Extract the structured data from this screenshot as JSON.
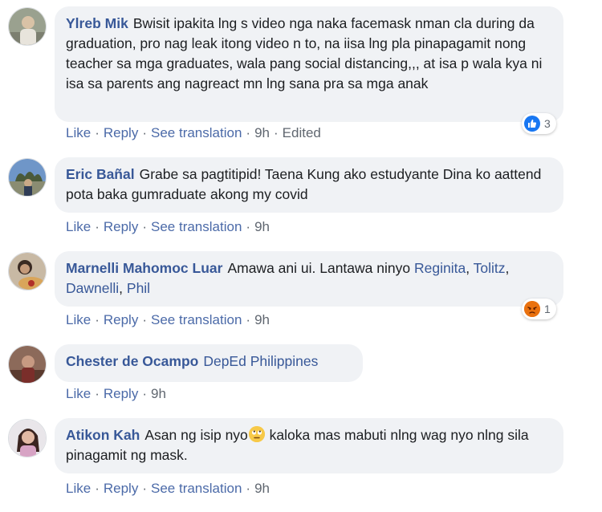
{
  "comments": [
    {
      "author": "Ylreb Mik",
      "text": "Bwisit ipakita lng s video nga naka facemask nman cla during da graduation, pro nag leak itong video n to, na iisa lng pla pinapagamit nong teacher sa mga graduates, wala pang social distancing,,, at isa p wala kya ni isa sa parents ang nagreact mn lng sana pra sa mga anak",
      "actions": {
        "like": "Like",
        "reply": "Reply",
        "translate": "See translation",
        "time": "9h",
        "edited": "Edited"
      },
      "reaction": {
        "icon": "like-reaction-icon",
        "count": "3"
      }
    },
    {
      "author": "Eric Bañal",
      "text": "Grabe sa pagtitipid! Taena Kung ako estudyante Dina ko aattend pota baka gumraduate akong my covid",
      "actions": {
        "like": "Like",
        "reply": "Reply",
        "translate": "See translation",
        "time": "9h"
      }
    },
    {
      "author": "Marnelli Mahomoc Luar",
      "text_prefix": "Amawa ani ui. Lantawa ninyo",
      "mentions": [
        "Reginita",
        "Tolitz",
        "Dawnelli",
        "Phil"
      ],
      "separator": ",",
      "actions": {
        "like": "Like",
        "reply": "Reply",
        "translate": "See translation",
        "time": "9h"
      },
      "reaction": {
        "icon": "angry-reaction-icon",
        "count": "1"
      }
    },
    {
      "author": "Chester de Ocampo",
      "mention": "DepEd Philippines",
      "actions": {
        "like": "Like",
        "reply": "Reply",
        "time": "9h"
      }
    },
    {
      "author": "Atikon Kah",
      "text_before_emoji": "Asan ng isip nyo",
      "emoji": "rolling-eyes-emoji-icon",
      "text_after_emoji": " kaloka mas mabuti nlng wag nyo nlng sila pinagamit ng mask.",
      "actions": {
        "like": "Like",
        "reply": "Reply",
        "translate": "See translation",
        "time": "9h"
      }
    }
  ],
  "colors": {
    "author_link": "#385898",
    "action_link": "#4b6aa8",
    "bubble_bg": "#f0f2f5",
    "like_blue": "#1877f2",
    "angry_orange": "#e9710f"
  }
}
